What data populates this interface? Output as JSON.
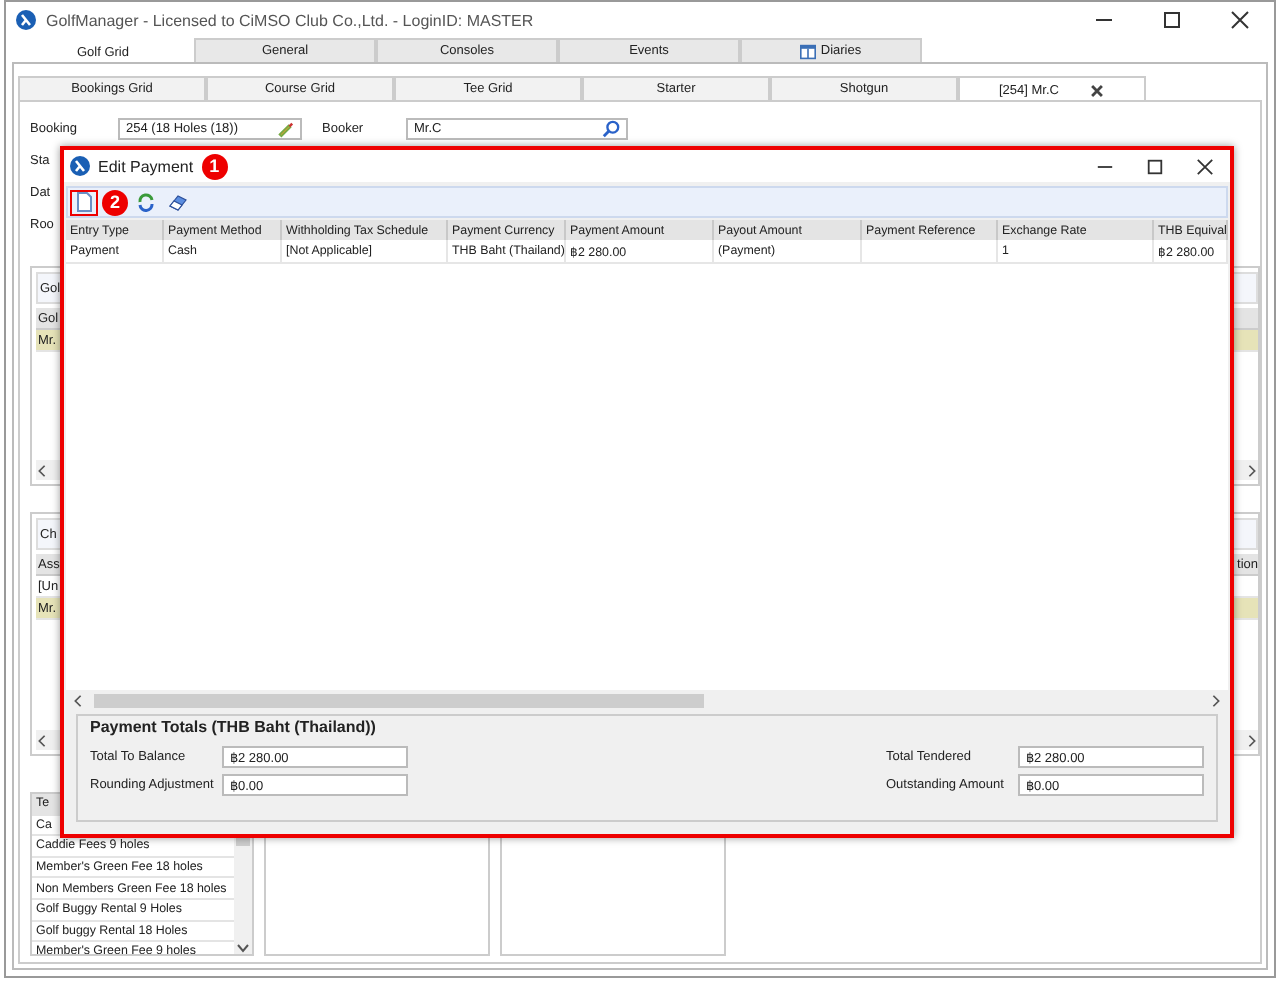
{
  "window": {
    "title": "GolfManager - Licensed to CiMSO Club Co.,Ltd. - LoginID: MASTER"
  },
  "main_tabs": [
    {
      "label": "Golf Grid",
      "selected": true,
      "has_icon": false
    },
    {
      "label": "General",
      "selected": false,
      "has_icon": false
    },
    {
      "label": "Consoles",
      "selected": false,
      "has_icon": false
    },
    {
      "label": "Events",
      "selected": false,
      "has_icon": false
    },
    {
      "label": "Diaries",
      "selected": false,
      "has_icon": true
    }
  ],
  "sub_tabs": [
    {
      "label": "Bookings Grid",
      "selected": false,
      "closable": false
    },
    {
      "label": "Course Grid",
      "selected": false,
      "closable": false
    },
    {
      "label": "Tee Grid",
      "selected": false,
      "closable": false
    },
    {
      "label": "Starter",
      "selected": false,
      "closable": false
    },
    {
      "label": "Shotgun",
      "selected": false,
      "closable": false
    },
    {
      "label": "[254] Mr.C",
      "selected": true,
      "closable": true
    }
  ],
  "form": {
    "booking": {
      "label": "Booking",
      "value": "254 (18 Holes (18))"
    },
    "booker": {
      "label": "Booker",
      "value": "Mr.C"
    },
    "partial_labels": [
      "Sta",
      "Dat",
      "Roo"
    ]
  },
  "panels": [
    {
      "title": "Gol",
      "header": "Gol",
      "rows": [
        {
          "text": "Mr.",
          "highlighted": true
        }
      ]
    },
    {
      "title": "Ch",
      "header": "Ass",
      "header_end": "tion",
      "rows": [
        {
          "text": "[Un",
          "highlighted": false
        },
        {
          "text": "Mr.",
          "highlighted": true
        }
      ]
    }
  ],
  "tenders_list": {
    "header": "Te",
    "items": [
      "Ca",
      "Caddie Fees 9 holes",
      "Member's Green Fee  18 holes",
      "Non Members Green Fee  18 holes",
      "Golf Buggy Rental 9 Holes",
      "Golf buggy Rental  18 Holes",
      "Member's Green Fee 9 holes"
    ]
  },
  "dialog": {
    "title": "Edit Payment",
    "callouts": [
      "1",
      "2"
    ],
    "columns": [
      "Entry Type",
      "Payment Method",
      "Withholding Tax Schedule",
      "Payment Currency",
      "Payment Amount",
      "Payout Amount",
      "Payment Reference",
      "Exchange Rate",
      "THB Equival"
    ],
    "rows": [
      [
        "Payment",
        "Cash",
        "[Not Applicable]",
        "THB Baht (Thailand)",
        "฿2 280.00",
        "(Payment)",
        "",
        "1",
        "฿2 280.00"
      ]
    ],
    "totals": {
      "title": "Payment Totals (THB Baht (Thailand))",
      "left": [
        {
          "label": "Total To Balance",
          "value": "฿2 280.00"
        },
        {
          "label": "Rounding Adjustment",
          "value": "฿0.00"
        }
      ],
      "right": [
        {
          "label": "Total Tendered",
          "value": "฿2 280.00"
        },
        {
          "label": "Outstanding Amount",
          "value": "฿0.00"
        }
      ]
    }
  }
}
